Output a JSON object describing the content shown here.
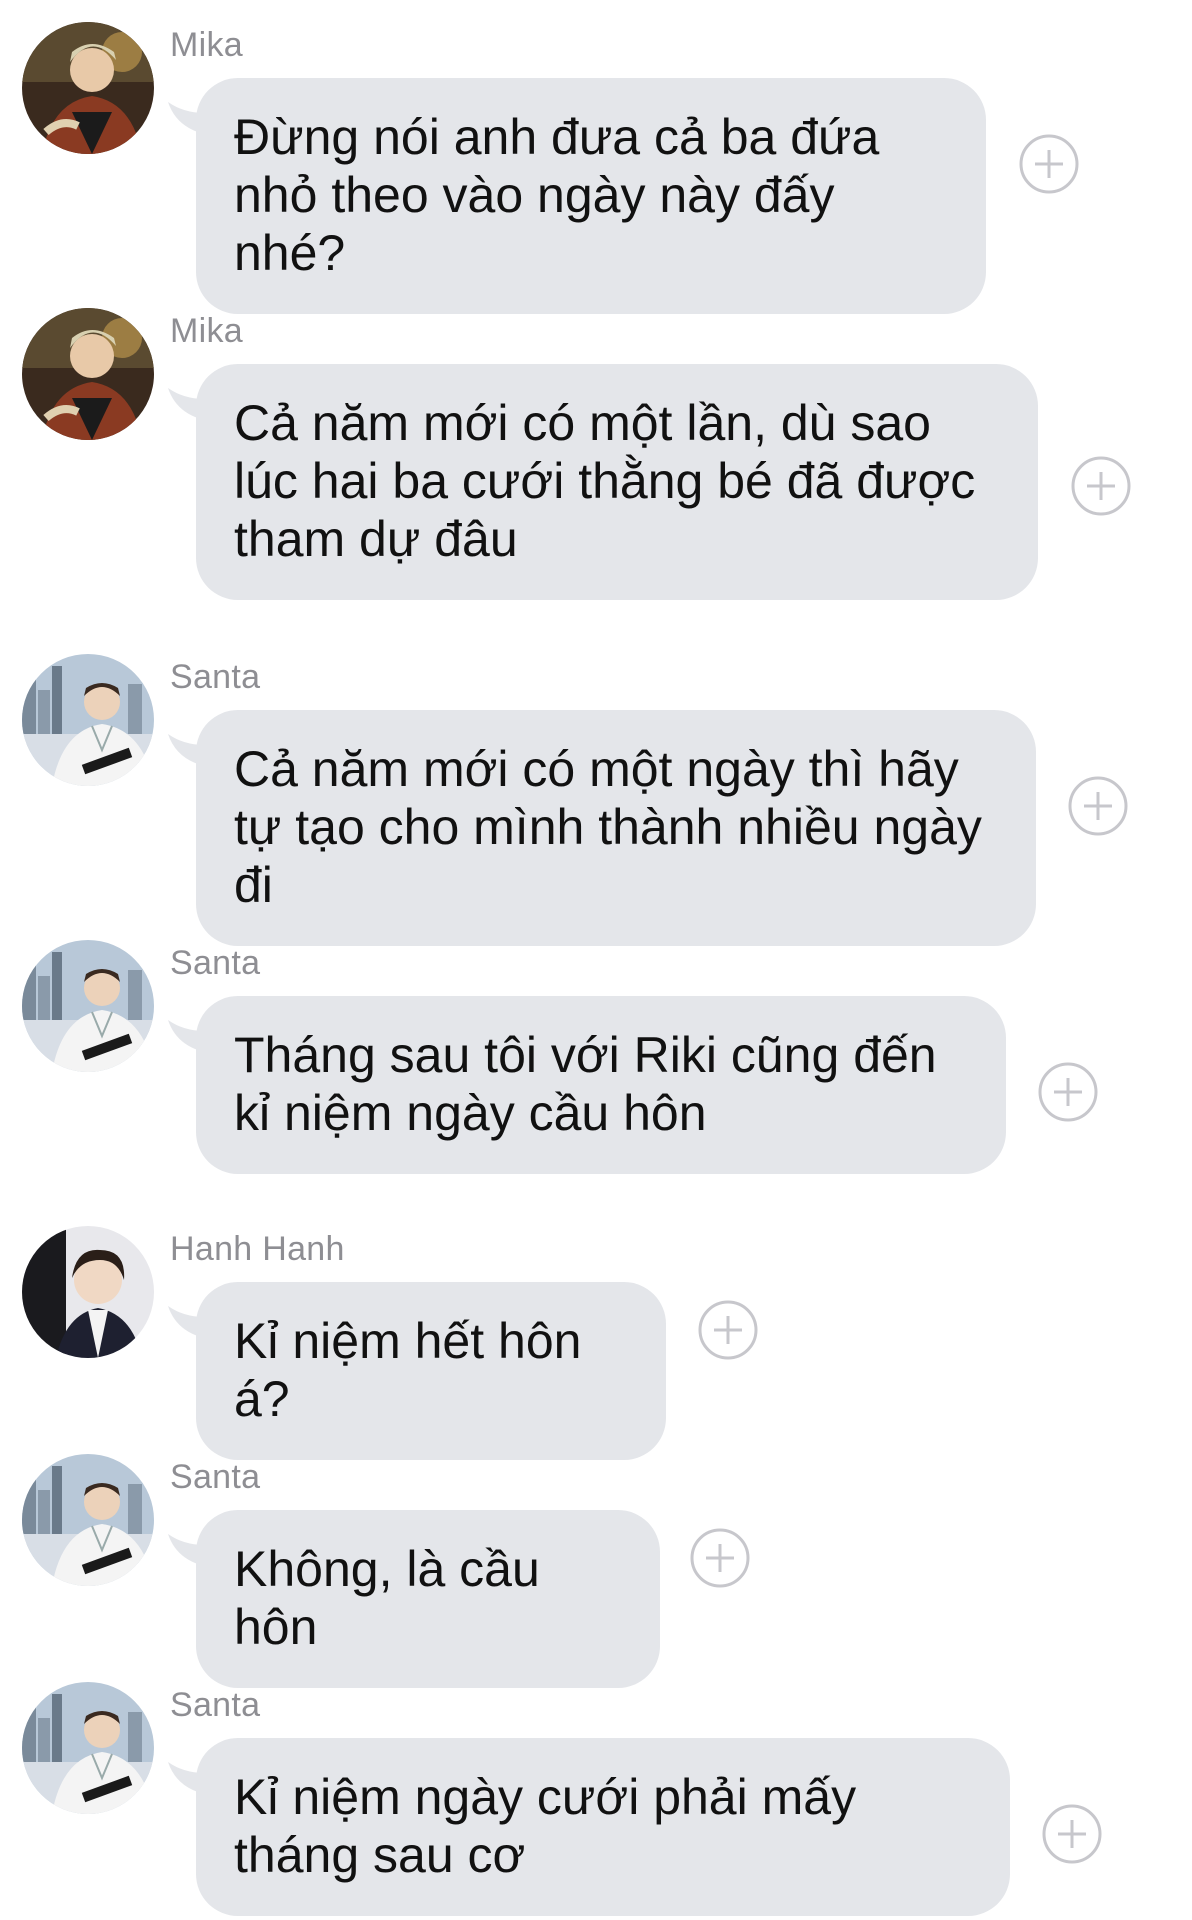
{
  "messages": [
    {
      "sender": "Mika",
      "avatar_icon": "avatar-mika",
      "text": "Đừng nói anh đưa cả ba đứa nhỏ theo vào ngày này đấy nhé?"
    },
    {
      "sender": "Mika",
      "avatar_icon": "avatar-mika",
      "text": "Cả năm mới có một lần, dù sao lúc hai ba cưới thằng bé đã được tham dự đâu"
    },
    {
      "sender": "Santa",
      "avatar_icon": "avatar-santa",
      "text": "Cả năm mới có một ngày thì hãy tự tạo cho mình thành nhiều ngày đi"
    },
    {
      "sender": "Santa",
      "avatar_icon": "avatar-santa",
      "text": "Tháng sau tôi với Riki cũng đến kỉ niệm ngày cầu hôn"
    },
    {
      "sender": "Hanh Hanh",
      "avatar_icon": "avatar-hanh-hanh",
      "text": "Kỉ niệm hết hôn á?"
    },
    {
      "sender": "Santa",
      "avatar_icon": "avatar-santa",
      "text": "Không, là cầu hôn"
    },
    {
      "sender": "Santa",
      "avatar_icon": "avatar-santa",
      "text": "Kỉ niệm ngày cưới phải mấy tháng sau cơ"
    }
  ],
  "colors": {
    "bubble": "#e4e6ea",
    "sender_name": "#8e8e93",
    "text": "#111111",
    "react_icon": "#c7c7cc"
  },
  "icons": {
    "reaction": "add-reaction-icon"
  }
}
